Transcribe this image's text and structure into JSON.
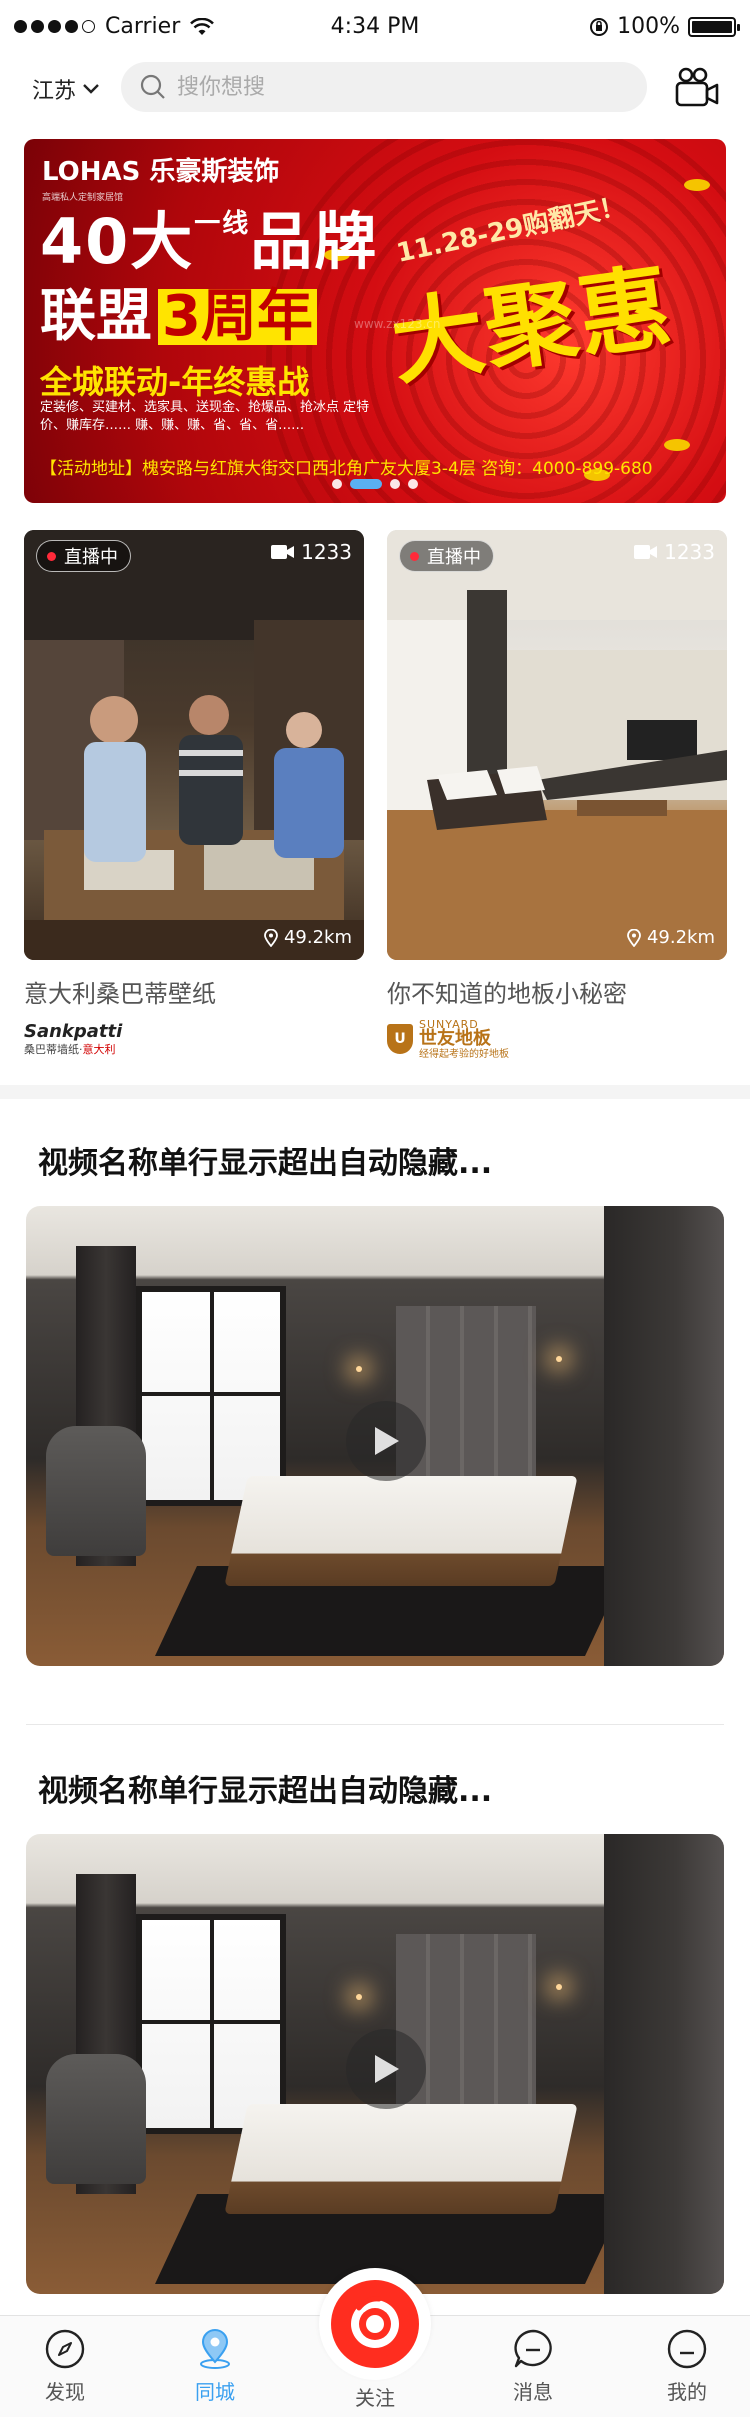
{
  "status_bar": {
    "carrier": "Carrier",
    "time": "4:34 PM",
    "battery": "100%"
  },
  "top_bar": {
    "location": "江苏",
    "search_placeholder": "搜你想搜"
  },
  "banner": {
    "logo": "LOHAS 乐豪斯装饰",
    "logo_sub": "高端私人定制家居馆",
    "headline_1": "40大",
    "headline_1_small": "一线",
    "headline_1b": "品牌",
    "headline_2a": "联盟",
    "headline_2b": "3周年",
    "headline_3": "全城联动-年终惠战",
    "sub_lines": "定装修、买建材、选家具、送现金、抢爆品、抢冰点 定特价、赚库存…… 赚、赚、赚、省、省、省……",
    "date_text": "11.28-29购翻天！",
    "big_text": "大聚惠",
    "watermark": "www.zx123.cn",
    "address": "【活动地址】槐安路与红旗大街交口西北角广友大厦3-4层  咨询：4000-899-680",
    "page_count": 4,
    "active_page": 2
  },
  "live_cards": [
    {
      "badge": "直播中",
      "viewers": "1233",
      "distance": "49.2km",
      "title": "意大利桑巴蒂壁纸",
      "brand_name": "Sankpatti",
      "brand_sub": "桑巴蒂墙纸",
      "brand_sub_red": "意大利"
    },
    {
      "badge": "直播中",
      "viewers": "1233",
      "distance": "49.2km",
      "title": "你不知道的地板小秘密",
      "brand_en": "SUNYARD",
      "brand_cn": "世友地板",
      "brand_tag": "经得起考验的好地板"
    }
  ],
  "videos": [
    {
      "title": "视频名称单行显示超出自动隐藏..."
    },
    {
      "title": "视频名称单行显示超出自动隐藏..."
    }
  ],
  "tab_bar": {
    "tabs": [
      {
        "label": "发现",
        "icon": "compass-icon"
      },
      {
        "label": "同城",
        "icon": "location-pin-icon",
        "active": true
      },
      {
        "label": "关注",
        "icon": "live-camera-icon"
      },
      {
        "label": "消息",
        "icon": "message-icon"
      },
      {
        "label": "我的",
        "icon": "profile-icon"
      }
    ],
    "active_color": "#3aa0f0",
    "center_color": "#ff2d1f"
  }
}
